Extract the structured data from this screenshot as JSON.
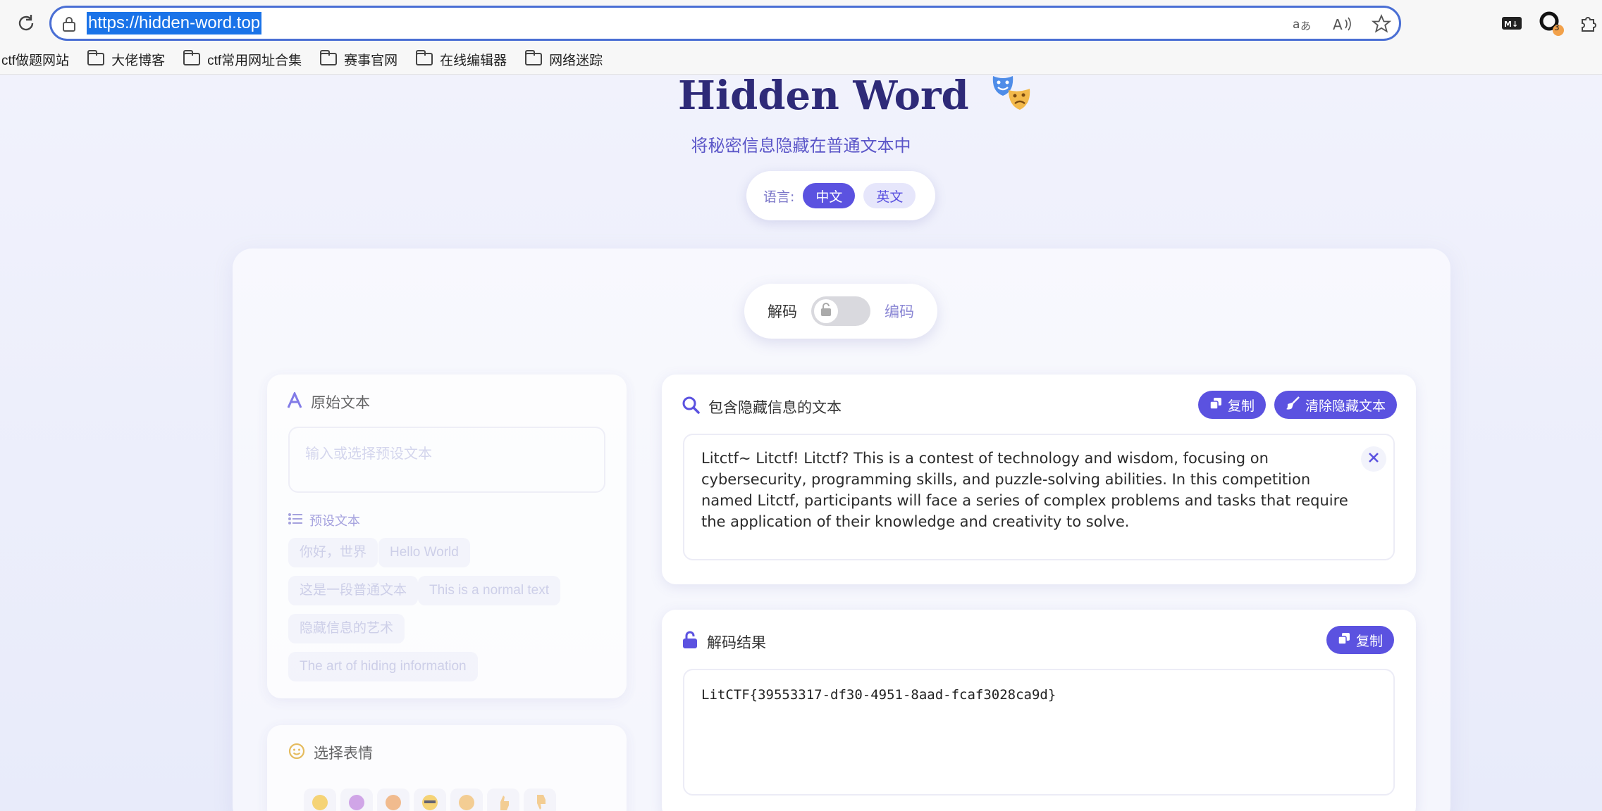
{
  "browser": {
    "url": "https://hidden-word.top",
    "extension_badge": "3",
    "bookmarks": [
      {
        "label": "ctf做题网站"
      },
      {
        "label": "大佬博客"
      },
      {
        "label": "ctf常用网址合集"
      },
      {
        "label": "赛事官网"
      },
      {
        "label": "在线编辑器"
      },
      {
        "label": "网络迷踪"
      }
    ]
  },
  "header": {
    "title": "Hidden Word",
    "subtitle": "将秘密信息隐藏在普通文本中",
    "language_label": "语言:",
    "lang_zh": "中文",
    "lang_en": "英文"
  },
  "mode": {
    "decode_label": "解码",
    "encode_label": "编码"
  },
  "original": {
    "title": "原始文本",
    "placeholder": "输入或选择预设文本",
    "presets_title": "预设文本",
    "presets": [
      "你好，世界",
      "Hello World",
      "这是一段普通文本",
      "This is a normal text",
      "隐藏信息的艺术",
      "The art of hiding information"
    ]
  },
  "emoji_panel": {
    "title": "选择表情"
  },
  "hidden_text": {
    "title": "包含隐藏信息的文本",
    "copy_label": "复制",
    "clear_label": "清除隐藏文本",
    "content": "Litctf~ Litctf! Litctf? This is a contest of technology and wisdom, focusing on cybersecurity, programming skills, and puzzle-solving abilities. In this competition named Litctf, participants will face a series of complex problems and tasks that require the application of their knowledge and creativity to solve."
  },
  "result": {
    "title": "解码结果",
    "copy_label": "复制",
    "content": "LitCTF{39553317-df30-4951-8aad-fcaf3028ca9d}"
  },
  "colors": {
    "accent": "#5b52e0",
    "title": "#2e2a78"
  }
}
